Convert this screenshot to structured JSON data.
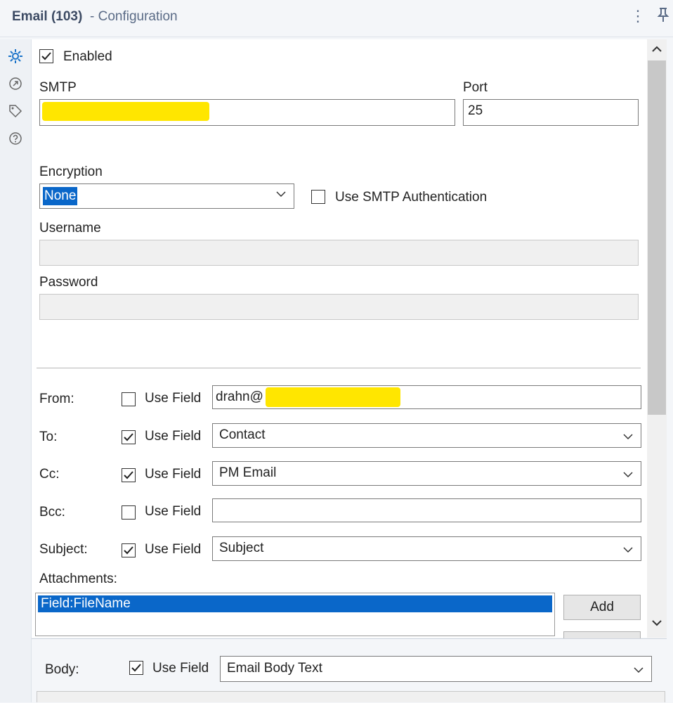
{
  "header": {
    "title": "Email (103)",
    "subtitle": "- Configuration",
    "menu_icon": "kebab-menu-icon",
    "pin_icon": "pin-icon"
  },
  "rail": {
    "icons": [
      "gear-icon",
      "connection-icon",
      "tag-icon",
      "help-icon"
    ]
  },
  "form": {
    "enabled_label": "Enabled",
    "enabled": true,
    "smtp_label": "SMTP",
    "smtp_value": "",
    "port_label": "Port",
    "port_value": "25",
    "encryption_label": "Encryption",
    "encryption_value": "None",
    "smtp_auth_label": "Use SMTP Authentication",
    "smtp_auth": false,
    "username_label": "Username",
    "password_label": "Password",
    "use_field_label": "Use Field",
    "from_label": "From:",
    "from_use_field": false,
    "from_value": "drahn@",
    "to_label": "To:",
    "to_use_field": true,
    "to_value": "Contact",
    "cc_label": "Cc:",
    "cc_use_field": true,
    "cc_value": "PM Email",
    "bcc_label": "Bcc:",
    "bcc_use_field": false,
    "bcc_value": "",
    "subject_label": "Subject:",
    "subject_use_field": true,
    "subject_value": "Subject",
    "attachments_label": "Attachments:",
    "attachments": [
      "Field:FileName"
    ],
    "add_label": "Add",
    "body_label": "Body:",
    "body_use_field": true,
    "body_value": "Email Body Text"
  },
  "colors": {
    "accent": "#0a67c9",
    "redaction": "#ffe600"
  }
}
